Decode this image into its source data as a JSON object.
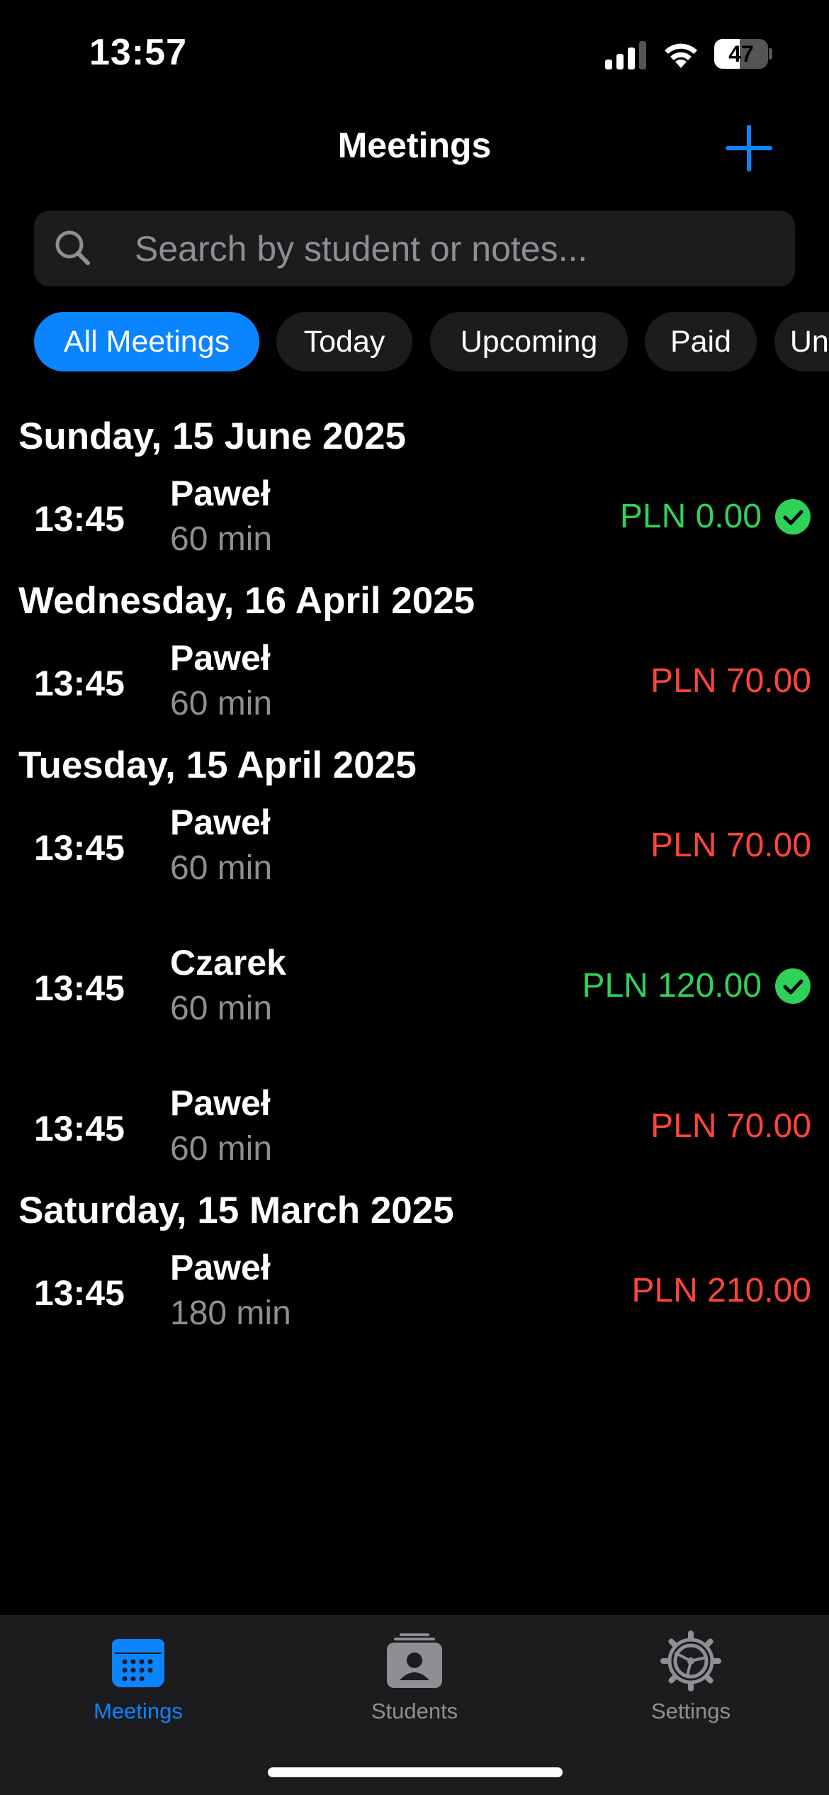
{
  "status_bar": {
    "time": "13:57",
    "battery_level": "47",
    "battery_fraction": 0.47
  },
  "nav": {
    "title": "Meetings",
    "add_icon": "plus-icon"
  },
  "search": {
    "placeholder": "Search by student or notes...",
    "value": "",
    "icon": "magnifying-glass-icon"
  },
  "filters": [
    {
      "label": "All Meetings",
      "active": true
    },
    {
      "label": "Today",
      "active": false
    },
    {
      "label": "Upcoming",
      "active": false
    },
    {
      "label": "Paid",
      "active": false
    },
    {
      "label": "Unpaid",
      "active": false
    }
  ],
  "sections": [
    {
      "date": "Sunday, 15 June 2025",
      "meetings": [
        {
          "time": "13:45",
          "name": "Paweł",
          "duration": "60 min",
          "price": "PLN 0.00",
          "paid": true
        }
      ]
    },
    {
      "date": "Wednesday, 16 April 2025",
      "meetings": [
        {
          "time": "13:45",
          "name": "Paweł",
          "duration": "60 min",
          "price": "PLN 70.00",
          "paid": false
        }
      ]
    },
    {
      "date": "Tuesday, 15 April 2025",
      "meetings": [
        {
          "time": "13:45",
          "name": "Paweł",
          "duration": "60 min",
          "price": "PLN 70.00",
          "paid": false
        },
        {
          "time": "13:45",
          "name": "Czarek",
          "duration": "60 min",
          "price": "PLN 120.00",
          "paid": true
        },
        {
          "time": "13:45",
          "name": "Paweł",
          "duration": "60 min",
          "price": "PLN 70.00",
          "paid": false
        }
      ]
    },
    {
      "date": "Saturday, 15 March 2025",
      "meetings": [
        {
          "time": "13:45",
          "name": "Paweł",
          "duration": "180 min",
          "price": "PLN 210.00",
          "paid": false
        }
      ]
    }
  ],
  "tabs": [
    {
      "label": "Meetings",
      "icon": "calendar-icon",
      "active": true
    },
    {
      "label": "Students",
      "icon": "students-icon",
      "active": false
    },
    {
      "label": "Settings",
      "icon": "gear-icon",
      "active": false
    }
  ],
  "colors": {
    "accent": "#0a84ff",
    "paid": "#30d158",
    "unpaid": "#ff453a",
    "secondary_text": "#8e8e93",
    "inactive_tab": "#8e8e93"
  }
}
